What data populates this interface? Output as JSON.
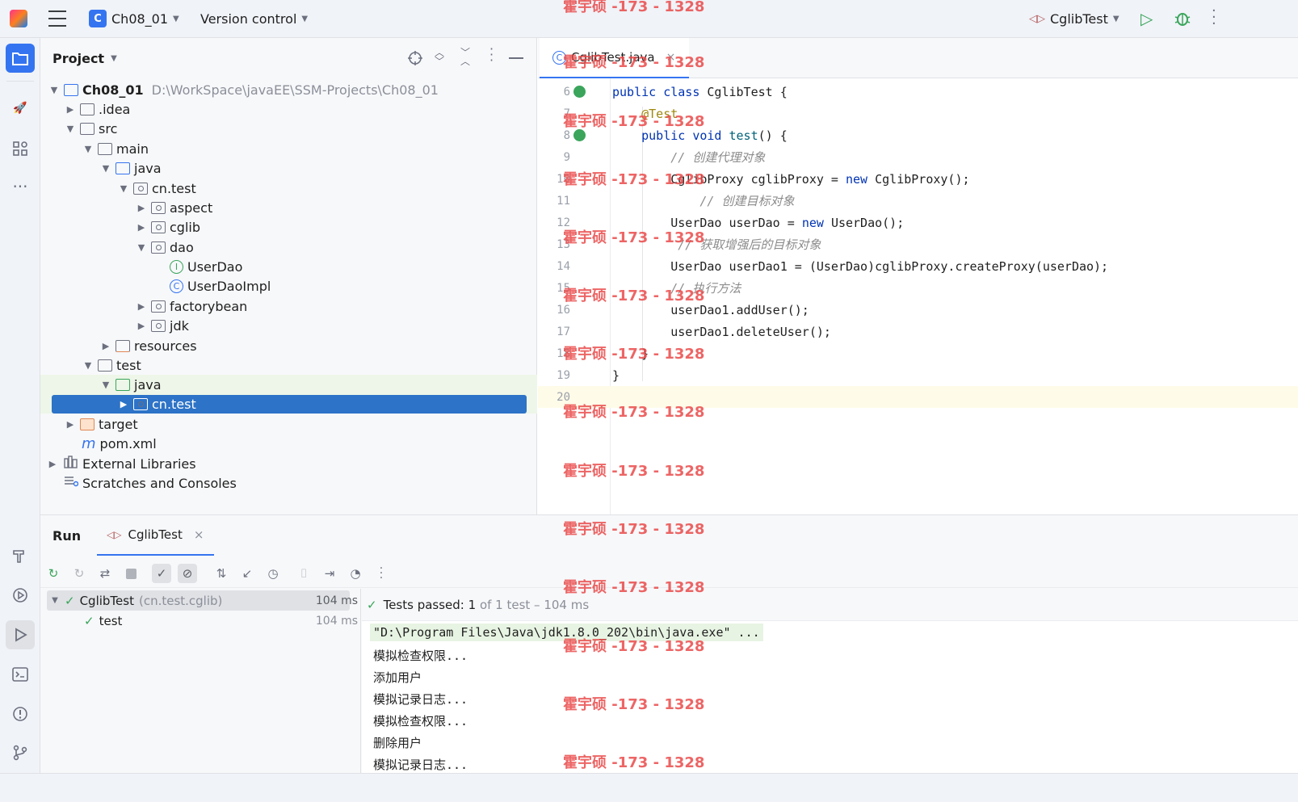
{
  "topbar": {
    "project_badge": "C",
    "project_name": "Ch08_01",
    "vcs_label": "Version control",
    "run_config": "CglibTest"
  },
  "project_panel": {
    "title": "Project",
    "tree": [
      {
        "label": "Ch08_01",
        "path": "D:\\WorkSpace\\javaEE\\SSM-Projects\\Ch08_01"
      },
      {
        "label": ".idea"
      },
      {
        "label": "src"
      },
      {
        "label": "main"
      },
      {
        "label": "java"
      },
      {
        "label": "cn.test"
      },
      {
        "label": "aspect"
      },
      {
        "label": "cglib"
      },
      {
        "label": "dao"
      },
      {
        "label": "UserDao",
        "icon": "I"
      },
      {
        "label": "UserDaoImpl",
        "icon": "C"
      },
      {
        "label": "factorybean"
      },
      {
        "label": "jdk"
      },
      {
        "label": "resources"
      },
      {
        "label": "test"
      },
      {
        "label": "java"
      },
      {
        "label": "cn.test"
      },
      {
        "label": "target"
      },
      {
        "label": "pom.xml",
        "icon": "m"
      },
      {
        "label": "External Libraries"
      },
      {
        "label": "Scratches and Consoles"
      }
    ]
  },
  "editor": {
    "tab_label": "CglibTest.java",
    "tab_icon": "C",
    "lines": [
      {
        "n": "6",
        "t": "public class CglibTest {"
      },
      {
        "n": "7",
        "t": "    @Test"
      },
      {
        "n": "8",
        "t": "    public void test() {"
      },
      {
        "n": "9",
        "t": "        // 创建代理对象"
      },
      {
        "n": "10",
        "t": "        CglibProxy cglibProxy = new CglibProxy();"
      },
      {
        "n": "11",
        "t": "            // 创建目标对象"
      },
      {
        "n": "12",
        "t": "        UserDao userDao = new UserDao();"
      },
      {
        "n": "13",
        "t": "         // 获取增强后的目标对象"
      },
      {
        "n": "14",
        "t": "        UserDao userDao1 = (UserDao)cglibProxy.createProxy(userDao);"
      },
      {
        "n": "15",
        "t": "        // 执行方法"
      },
      {
        "n": "16",
        "t": "        userDao1.addUser();"
      },
      {
        "n": "17",
        "t": "        userDao1.deleteUser();"
      },
      {
        "n": "18",
        "t": "    }"
      },
      {
        "n": "19",
        "t": "}"
      },
      {
        "n": "20",
        "t": ""
      }
    ]
  },
  "run_panel": {
    "title": "Run",
    "tab_label": "CglibTest",
    "tests": [
      {
        "name": "CglibTest",
        "pkg": "(cn.test.cglib)",
        "time": "104 ms"
      },
      {
        "name": "test",
        "time": "104 ms"
      }
    ],
    "summary_prefix": "Tests passed: ",
    "summary_count": "1",
    "summary_rest": " of 1 test – 104 ms",
    "console": [
      "\"D:\\Program Files\\Java\\jdk1.8.0_202\\bin\\java.exe\" ...",
      "模拟检查权限...",
      "添加用户",
      "模拟记录日志...",
      "模拟检查权限...",
      "删除用户",
      "模拟记录日志..."
    ]
  },
  "watermark": "霍宇硕 -173 - 1328"
}
